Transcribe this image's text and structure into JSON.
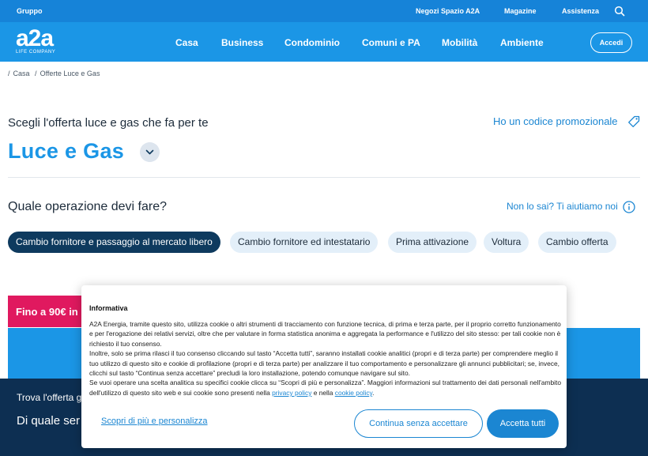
{
  "topbar": {
    "gruppo": "Gruppo",
    "links": [
      "Negozi Spazio A2A",
      "Magazine",
      "Assistenza"
    ],
    "search_icon": "search-icon"
  },
  "nav": {
    "logo_mark": "a2a",
    "logo_sub": "LIFE COMPANY",
    "items": [
      "Casa",
      "Business",
      "Condominio",
      "Comuni e PA",
      "Mobilità",
      "Ambiente"
    ],
    "login": "Accedi"
  },
  "breadcrumb": [
    "Casa",
    "Offerte Luce e Gas"
  ],
  "offer": {
    "subtitle": "Scegli l'offerta luce e gas che fa per te",
    "title": "Luce e Gas",
    "promo_link": "Ho un codice promozionale",
    "question": "Quale operazione devi fare?",
    "help_link": "Non lo sai? Ti aiutiamo noi",
    "chips": [
      {
        "label": "Cambio fornitore e passaggio al mercato libero",
        "selected": true
      },
      {
        "label": "Cambio fornitore ed intestatario",
        "selected": false
      },
      {
        "label": "Prima attivazione",
        "selected": false
      },
      {
        "label": "Voltura",
        "selected": false
      },
      {
        "label": "Cambio offerta",
        "selected": false
      }
    ]
  },
  "background": {
    "promo_tag": "Fino a 90€ in",
    "band_line1": "Trova l'offerta g",
    "band_line2": "Di quale ser"
  },
  "cookie": {
    "title": "Informativa",
    "p1": "A2A Energia, tramite questo sito, utilizza cookie o altri strumenti di tracciamento con funzione tecnica, di prima e terza parte, per il proprio corretto funzionamento e per l'erogazione dei relativi servizi, oltre che per valutare in forma statistica anonima e aggregata la performance e l'utilizzo del sito stesso: per tali cookie non è richiesto il tuo consenso.",
    "p2": "Inoltre, solo se prima rilasci il tuo consenso cliccando sul tasto “Accetta tutti”, saranno installati cookie analitici (propri e di terza parte) per comprendere meglio il tuo utilizzo di questo sito e cookie di profilazione (propri e di terza parte) per analizzare il tuo comportamento e personalizzare gli annunci pubblicitari; se, invece, clicchi sul tasto “Continua senza accettare” precludi la loro installazione, potendo comunque navigare sul sito.",
    "p3_start": "Se vuoi operare una scelta analitica su specifici cookie clicca su “Scopri di più e personalizza”. Maggiori informazioni sul trattamento dei dati personali nell'ambito dell'utilizzo di questo sito web e sui cookie sono presenti nella ",
    "privacy_link": "privacy policy",
    "p3_mid": " e nella ",
    "cookie_link": "cookie policy",
    "p3_end": ".",
    "more_link": "Scopri di più e personalizza",
    "reject_button": "Continua senza accettare",
    "accept_button": "Accetta tutti"
  },
  "colors": {
    "brand_blue": "#1b96e6",
    "navy": "#0d2f52",
    "accent_pink": "#e0195f",
    "link_blue": "#1b86d2"
  }
}
